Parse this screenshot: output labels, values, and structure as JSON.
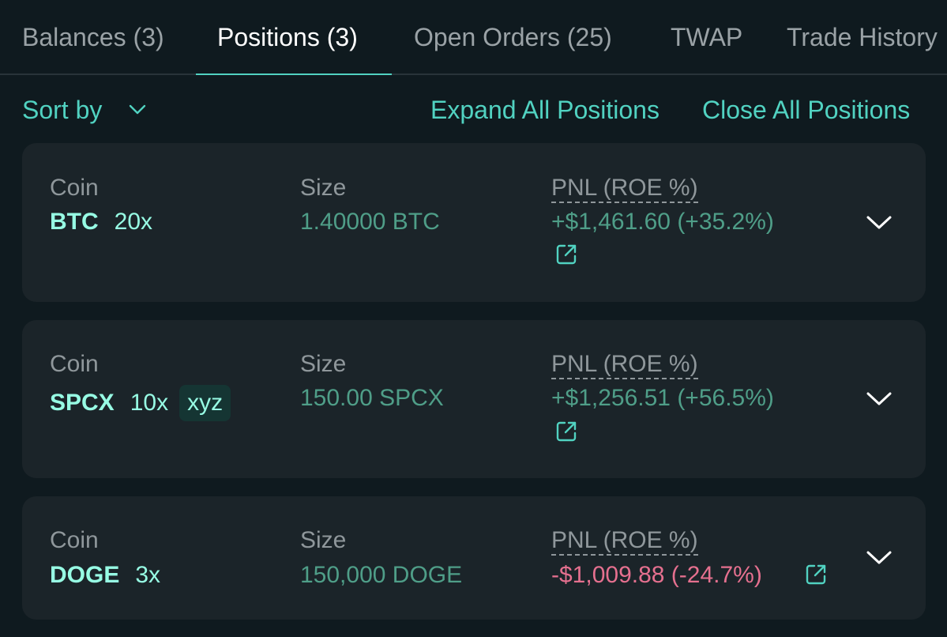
{
  "tabs": [
    {
      "label": "Balances (3)"
    },
    {
      "label": "Positions (3)"
    },
    {
      "label": "Open Orders (25)"
    },
    {
      "label": "TWAP"
    },
    {
      "label": "Trade History"
    }
  ],
  "active_tab": "Positions (3)",
  "actions": {
    "sort_label": "Sort by",
    "expand_all": "Expand All Positions",
    "close_all": "Close All Positions"
  },
  "positions": [
    {
      "coin_label": "Coin",
      "coin": "BTC",
      "leverage": "20x",
      "tag": "",
      "size_label": "Size",
      "size": "1.40000 BTC",
      "pnl_label": "PNL (ROE %)",
      "pnl": "+$1,461.60 (+35.2%)",
      "direction": "up"
    },
    {
      "coin_label": "Coin",
      "coin": "SPCX",
      "leverage": "10x",
      "tag": "xyz",
      "size_label": "Size",
      "size": "150.00 SPCX",
      "pnl_label": "PNL (ROE %)",
      "pnl": "+$1,256.51 (+56.5%)",
      "direction": "up"
    },
    {
      "coin_label": "Coin",
      "coin": "DOGE",
      "leverage": "3x",
      "tag": "",
      "size_label": "Size",
      "size": "150,000 DOGE",
      "pnl_label": "PNL (ROE %)",
      "pnl": "-$1,009.88 (-24.7%)",
      "direction": "down"
    }
  ],
  "colors": {
    "accent": "#51d2c1",
    "coin": "#97fce4",
    "positive": "#4f9e88",
    "negative": "#e5708f",
    "card_bg": "#1b2429",
    "page_bg": "#0f1a1f"
  },
  "icons": {
    "sort_dropdown": "chevron-down-icon",
    "external_link": "external-link-icon",
    "expand": "chevron-down-icon"
  }
}
